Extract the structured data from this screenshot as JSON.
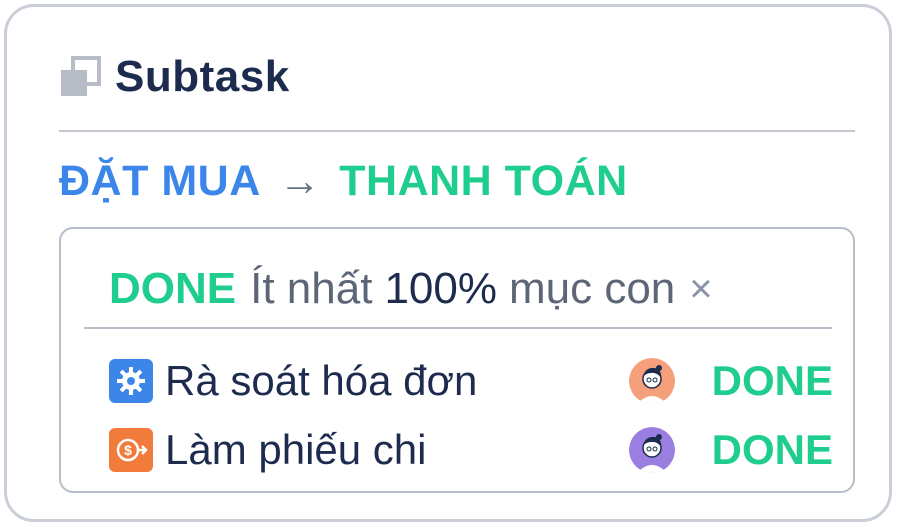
{
  "header": {
    "title": "Subtask",
    "icon": "subtask-icon"
  },
  "transition": {
    "from": "ĐẶT MUA",
    "arrow": "→",
    "to": "THANH TOÁN"
  },
  "condition": {
    "status": "DONE",
    "prefix": "Ít nhất",
    "percent": "100%",
    "suffix": "mục con",
    "close": "×"
  },
  "subtasks": [
    {
      "name": "Rà soát hóa đơn",
      "status": "DONE",
      "icon": "gear-icon",
      "avatar_bg": "#f5a07a"
    },
    {
      "name": "Làm phiếu chi",
      "status": "DONE",
      "icon": "dollar-arrow-icon",
      "avatar_bg": "#9b7fe0"
    }
  ],
  "colors": {
    "title": "#1d2b4f",
    "from_status": "#3b86e8",
    "done_status": "#1fce8e",
    "border": "#c9ced8",
    "blue_icon": "#3b86e8",
    "orange_icon": "#f27b3c"
  }
}
